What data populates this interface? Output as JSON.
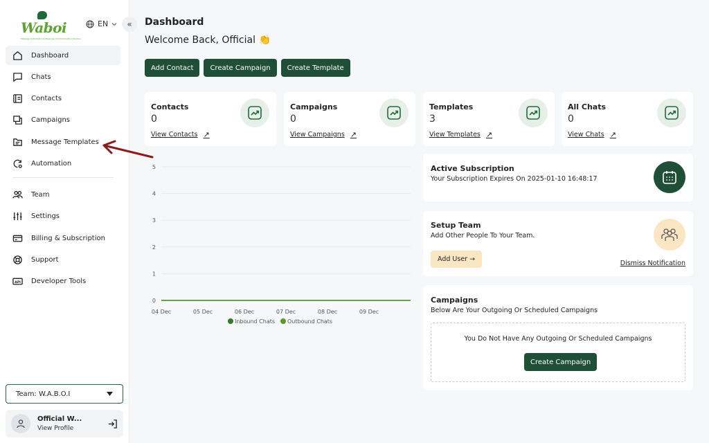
{
  "brand": {
    "logo_text": "Waboi",
    "tagline": "Message Automation & Business Communication Solution",
    "language": "EN"
  },
  "sidebar": {
    "items": [
      {
        "label": "Dashboard",
        "icon": "home-icon",
        "active": true
      },
      {
        "label": "Chats",
        "icon": "chat-icon"
      },
      {
        "label": "Contacts",
        "icon": "contacts-icon"
      },
      {
        "label": "Campaigns",
        "icon": "campaigns-icon"
      },
      {
        "label": "Message Templates",
        "icon": "templates-icon"
      },
      {
        "label": "Automation",
        "icon": "automation-icon"
      },
      {
        "label": "Team",
        "icon": "team-icon"
      },
      {
        "label": "Settings",
        "icon": "settings-icon"
      },
      {
        "label": "Billing & Subscription",
        "icon": "billing-icon"
      },
      {
        "label": "Support",
        "icon": "support-icon"
      },
      {
        "label": "Developer Tools",
        "icon": "api-icon"
      }
    ],
    "team_select": "Team: W.A.B.O.I",
    "profile_name": "Official W...",
    "profile_link": "View Profile"
  },
  "header": {
    "title": "Dashboard",
    "welcome": "Welcome Back, Official 👏"
  },
  "actions": {
    "add_contact": "Add Contact",
    "create_campaign": "Create Campaign",
    "create_template": "Create Template"
  },
  "stats": [
    {
      "title": "Contacts",
      "value": "0",
      "link": "View Contacts"
    },
    {
      "title": "Campaigns",
      "value": "0",
      "link": "View Campaigns"
    },
    {
      "title": "Templates",
      "value": "3",
      "link": "View Templates"
    },
    {
      "title": "All Chats",
      "value": "0",
      "link": "View Chats"
    }
  ],
  "subscription": {
    "title": "Active Subscription",
    "text": "Your Subscription Expires On 2025-01-10 16:48:17"
  },
  "setup_team": {
    "title": "Setup Team",
    "text": "Add Other People To Your Team.",
    "add_user": "Add User →",
    "dismiss": "Dismiss Notification"
  },
  "campaigns_panel": {
    "title": "Campaigns",
    "text": "Below Are Your Outgoing Or Scheduled Campaigns",
    "empty": "You Do Not Have Any Outgoing Or Scheduled Campaigns",
    "button": "Create Campaign"
  },
  "colors": {
    "primary": "#1f4f36",
    "accent_green": "#5aa52e",
    "inbound": "#2f7d1e",
    "outbound": "#5c9b2a",
    "annotation_arrow": "#8b1a1a"
  },
  "chart_data": {
    "type": "line",
    "x": [
      "04 Dec",
      "05 Dec",
      "06 Dec",
      "07 Dec",
      "08 Dec",
      "09 Dec"
    ],
    "ylim": [
      0,
      5
    ],
    "yticks": [
      "0",
      "1",
      "2",
      "3",
      "4",
      "5"
    ],
    "series": [
      {
        "name": "Inbound Chats",
        "values": [
          0,
          0,
          0,
          0,
          0,
          0
        ]
      },
      {
        "name": "Outbound Chats",
        "values": [
          0,
          0,
          0,
          0,
          0,
          0
        ]
      }
    ],
    "grid": true,
    "legend": "bottom"
  }
}
